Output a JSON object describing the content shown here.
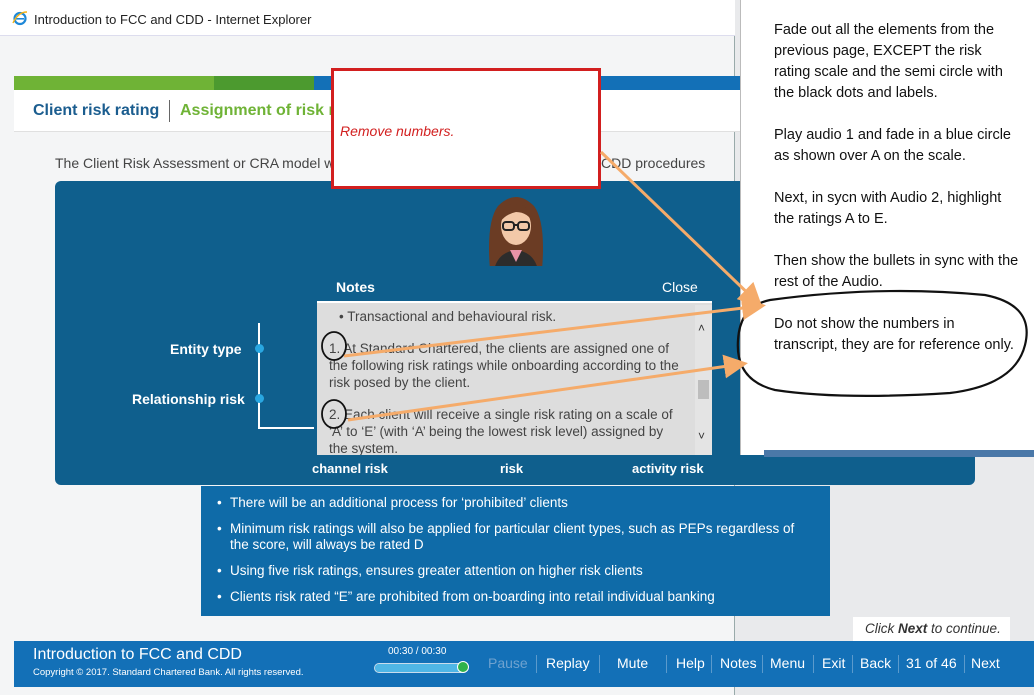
{
  "browser": {
    "title": "Introduction to FCC and CDD - Internet Explorer",
    "icon": "ie-logo-icon"
  },
  "header": {
    "crumb_1": "Client risk rating",
    "crumb_2": "Assignment of risk r"
  },
  "colors": {
    "brand_blue": "#1370b7",
    "panel_blue": "#0f5f8d",
    "accent_green": "#6fb336",
    "annotation_red": "#d21f1f",
    "arrow_orange": "#f5ab6a"
  },
  "content": {
    "intro_left": "The Client Risk Assessment or CRA model w",
    "intro_right": "CDD procedures",
    "side_labels": {
      "entity_type": "Entity type",
      "relationship_risk": "Relationship risk"
    },
    "bottom_labels": [
      "channel risk",
      "risk",
      "activity risk"
    ],
    "bullets": [
      "There will be an additional process for ‘prohibited’ clients",
      "Minimum risk ratings will also be applied for particular client types, such as PEPs regardless of the score, will always be rated D",
      "Using five risk ratings, ensures greater attention on higher risk clients",
      "Clients risk rated “E” are prohibited from on-boarding into retail individual banking"
    ],
    "continue_prefix": "Click ",
    "continue_bold": "Next",
    "continue_suffix": " to continue."
  },
  "notes": {
    "title": "Notes",
    "close_label": "Close",
    "lines": [
      "•  Transactional and behavioural risk.",
      "1. At Standard Chartered, the clients are assigned one of the following risk ratings while onboarding according to the risk posed by the client.",
      "2. Each client will receive a single risk rating on a scale of ‘A’ to ‘E’ (with ‘A’ being the lowest risk level) assigned by the system."
    ]
  },
  "footer": {
    "course_title": "Introduction to FCC and CDD",
    "copyright": "Copyright © 2017. Standard Chartered Bank. All rights reserved.",
    "time": "00:30 / 00:30",
    "progress": 1.0,
    "nav": {
      "pause": "Pause",
      "replay": "Replay",
      "mute": "Mute",
      "help": "Help",
      "notes": "Notes",
      "menu": "Menu",
      "exit": "Exit",
      "back": "Back",
      "page": "31 of 46",
      "next": "Next"
    }
  },
  "annotations": {
    "red_callout": "Remove numbers.",
    "instructions": [
      "Fade out all the elements from the previous page, EXCEPT the risk rating scale and the semi circle with the black dots and labels.",
      "Play  audio 1 and fade in a blue circle as shown over A on the scale.",
      "Next, in sycn with Audio 2, highlight the ratings A to E.",
      "Then show the bullets in sync with the rest of the Audio.",
      "Do not show the numbers in transcript, they are for reference only."
    ]
  }
}
